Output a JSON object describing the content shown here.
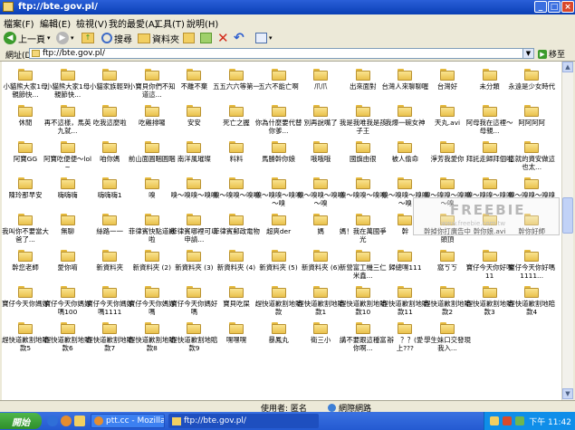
{
  "window": {
    "title": "ftp://bte.gov.pl/"
  },
  "menu": [
    "檔案(F)",
    "編輯(E)",
    "檢視(V)",
    "我的最愛(A)",
    "工具(T)",
    "說明(H)"
  ],
  "toolbar": {
    "back_label": "上一頁",
    "search_label": "搜尋",
    "folders_label": "資料夾"
  },
  "address": {
    "label": "網址(D)",
    "value": "ftp://bte.gov.pl/",
    "go_label": "移至"
  },
  "folders": [
    "小貓熊大家1母親節快...",
    "小貓熊大家1母親節快...",
    "小貓家族輕到",
    "小寶貝你們不知道這...",
    "不離不棄",
    "五五六六等第一",
    "五六不能亡啊",
    "爪爪",
    "出來面對",
    "台灣人來聊聊喔",
    "台灣好",
    "未分類",
    "永遠是少女時代",
    "休閒",
    "再不這樣，馬英九就...",
    "吃我這麼啦",
    "吃雞排囉",
    "安安",
    "死亡之握",
    "你為什麼要代替你爹...",
    "別再說嘴了",
    "我是我唯我是孩子王",
    "我爆一碗女神",
    "天丸.avi",
    "阿母我在這裡～母親...",
    "阿阿阿阿",
    "阿寶GG",
    "阿寶吃便便～lol~",
    "咱你媽",
    "前山面圓睏圓睏",
    "南洋風璀璨",
    "料料",
    "馬勝幹你娘",
    "哦哦哦",
    "國旗由很",
    "被人偷命",
    "淨芳我愛你",
    "拜託走歸拜個啦",
    "這就的資安做這也太...",
    "陳玲那早安",
    "嗨嗨嗨",
    "嗨嗨嗨1",
    "嗅",
    "嗅～嗅嗅～嗅嗅",
    "嗅～嗅嗅～嗅嗅",
    "嗅～嗅嗅～嗅嗅～嗅",
    "嗅～嗅嗅～嗅嗅～嗅",
    "嗅～嗅嗅～嗅嗅",
    "嗅～嗅嗅～嗅嗅～嗅",
    "嗅～嗅嗅～嗅嗅～嗅",
    "嗅～嗅嗅～嗅嗅",
    "嗅～嗅嗅～嗅嗅",
    "我叫你不要當大爸了...",
    "無聊",
    "絲路一一",
    "菲律賓快點道歉啦",
    "菲律賓哪裡可以申請...",
    "菲律賓郵政電物",
    "超爽der",
    "媽",
    "媽！我在萬國爭光",
    "幹",
    "幹掉你打廣告中頭頂",
    "幹你娘.avi",
    "幹你好師",
    "幹您老師",
    "愛你唷",
    "新資料夾",
    "新資料夾 (2)",
    "新資料夾 (3)",
    "新資料夾 (4)",
    "新資料夾 (5)",
    "新資料夾 (6)",
    "新營富工機三仁米鑫...",
    "歸總嘿111",
    "窩ㄎㄎ",
    "寶仔今天你好嗎11",
    "寶仔今天你好嗎1111...",
    "寶仔今天你媽好",
    "寶仔今天你媽好嗎100",
    "寶仔今天你媽好嗎1111",
    "寶仔今天你媽好嗎",
    "寶仔今天你媽好嗎",
    "寶貝吃屎",
    "趕快道歉割地賠款",
    "趕快道歉割地賠款1",
    "趕快道歉割地賠款10",
    "趕快道歉割地賠款11",
    "趕快道歉割地賠款2",
    "趕快道歉割地賠款3",
    "趕快道歉割地賠款4",
    "趕快道歉割地賠款5",
    "趕快道歉割地賠款6",
    "趕快道歉割地賠款7",
    "趕快道歉割地賠款8",
    "趕快道歉割地賠款9",
    "嘿嘿嘿",
    "暴鳳丸",
    "衛三小",
    "講不要跟這種富你啊...",
    "辦　？？(愛上???",
    "學生妹口交發現我入..."
  ],
  "watermark": {
    "text": "FREEBIE",
    "sub": "www.freebie.com.tw"
  },
  "status": {
    "user_label": "使用者: 匿名",
    "zone_label": "網際網路"
  },
  "taskbar": {
    "start_label": "開始",
    "tasks": [
      "ptt.cc - Mozilla Firefox",
      "ftp://bte.gov.pl/"
    ],
    "clock": "下午 11:42"
  },
  "colors": {
    "titlebar": "#0a3fb5",
    "taskbar": "#245ad1",
    "folder": "#f2cf62",
    "start": "#3c9b2c"
  }
}
